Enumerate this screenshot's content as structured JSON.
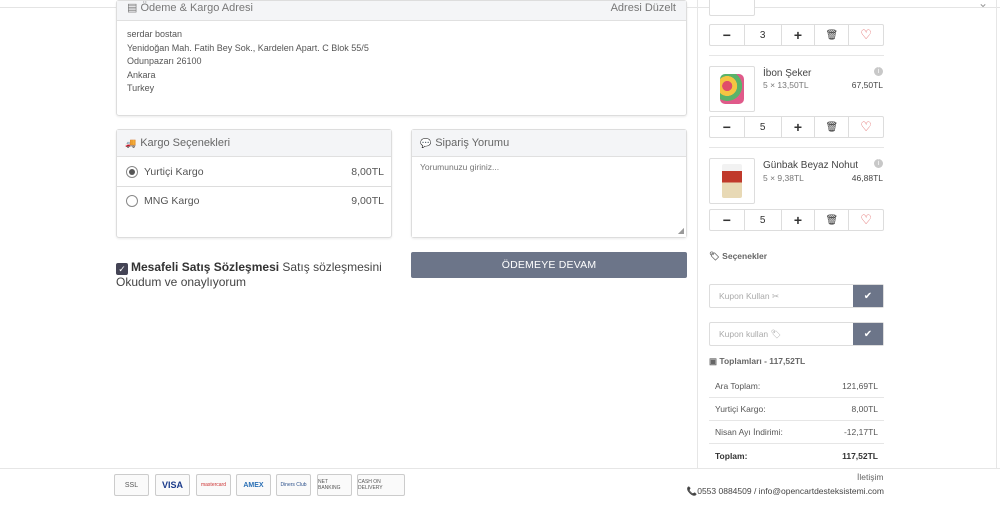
{
  "address": {
    "title": "Ödeme & Kargo Adresi",
    "change_label": "Adresi Düzelt",
    "lines": [
      "serdar bostan",
      "Yenidoğan Mah. Fatih Bey Sok., Kardelen Apart. C Blok 55/5",
      "Odunpazarı 26100",
      "Ankara",
      "Turkey"
    ]
  },
  "cargo": {
    "title": "Kargo Seçenekleri",
    "options": [
      {
        "name": "Yurtiçi Kargo",
        "price": "8,00TL",
        "selected": true
      },
      {
        "name": "MNG Kargo",
        "price": "9,00TL",
        "selected": false
      }
    ]
  },
  "comment": {
    "title": "Sipariş Yorumu",
    "placeholder": "Yorumunuzu giriniz..."
  },
  "agreement": {
    "bold": "Mesafeli Satış Sözleşmesi",
    "rest": " Satış sözleşmesini Okudum ve onaylıyorum"
  },
  "continue_label": "ÖDEMEYE DEVAM",
  "cart": {
    "items": [
      {
        "name": "",
        "sub": "",
        "total": "",
        "qty": "3"
      },
      {
        "name": "İbon Şeker",
        "sub": "5 × 13,50TL",
        "total": "67,50TL",
        "qty": "5"
      },
      {
        "name": "Günbak Beyaz Nohut",
        "sub": "5 × 9,38TL",
        "total": "46,88TL",
        "qty": "5"
      }
    ],
    "qty_minus": "−",
    "qty_plus": "+"
  },
  "options_title": "Seçenekler",
  "coupon_placeholder": "Kupon Kullan",
  "voucher_placeholder": "Kupon kullan",
  "totals": {
    "title": "Toplamları - 117,52TL",
    "rows": [
      {
        "label": "Ara Toplam:",
        "value": "121,69TL"
      },
      {
        "label": "Yurtiçi Kargo:",
        "value": "8,00TL"
      },
      {
        "label": "Nisan Ayı İndirimi:",
        "value": "-12,17TL"
      },
      {
        "label": "Toplam:",
        "value": "117,52TL"
      }
    ]
  },
  "footer": {
    "payments": [
      "SSL",
      "VISA",
      "mastercard",
      "AMEX",
      "Diners Club",
      "NET BANKING",
      "CASH ON DELIVERY"
    ],
    "contact_title": "İletişim",
    "contact": "0553 0884509 / info@opencartdesteksistemi.com"
  },
  "colors": {
    "accent": "#6c7589",
    "heart": "#dd5555"
  }
}
